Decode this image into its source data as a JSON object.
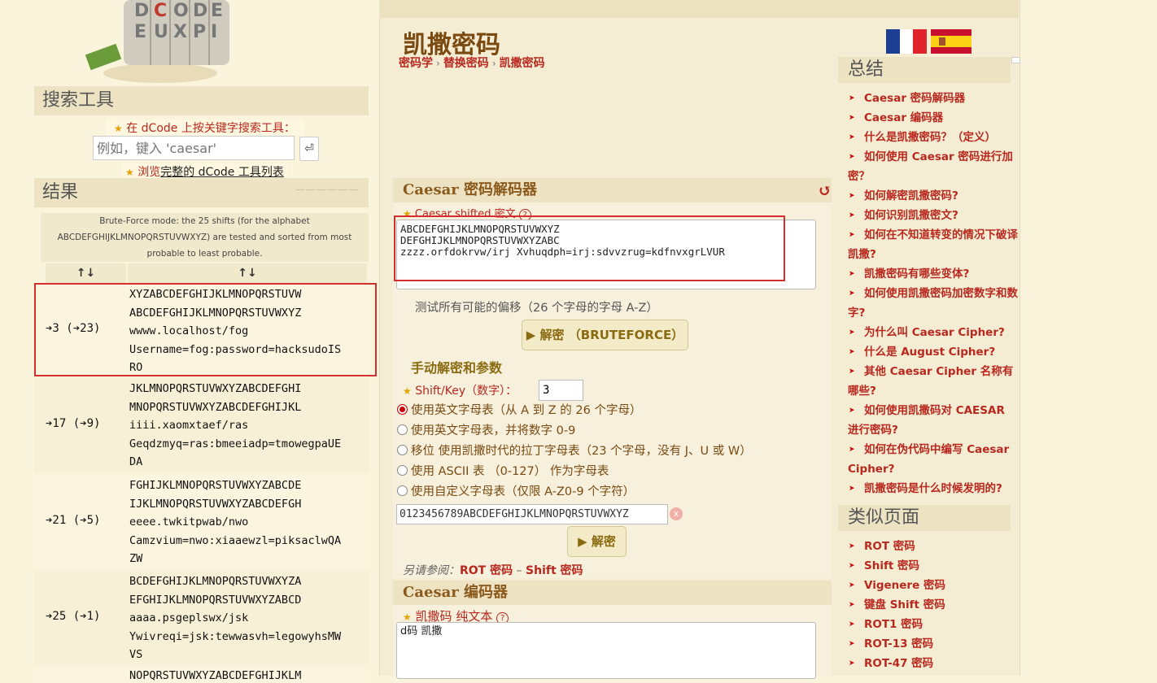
{
  "left": {
    "logo_letters": "DCODE",
    "search_title": "搜索工具",
    "search_intro": "在 dCode 上按关键字搜索工具：",
    "search_placeholder": "例如，键入 'caesar'",
    "search_btn": "⏎",
    "browse_prefix": "浏览",
    "browse_link": "完整的 dCode 工具列表",
    "results_title": "结果",
    "results_note": "Brute-Force mode: the 25 shifts (for the alphabet ABCDEFGHIJKLMNOPQRSTUVWXYZ) are tested and sorted from most probable to least probable.",
    "col1": "↑↓",
    "col2": "↑↓",
    "rows": [
      {
        "shift": "➔3 (➔23)",
        "lines": [
          "XYZABCDEFGHIJKLMNOPQRSTUVW",
          "ABCDEFGHIJKLMNOPQRSTUVWXYZ",
          "wwww.localhost/fog",
          "Username=fog:password=hacksudoIS",
          "RO"
        ]
      },
      {
        "shift": "➔17 (➔9)",
        "lines": [
          "JKLMNOPQRSTUVWXYZABCDEFGHI",
          "MNOPQRSTUVWXYZABCDEFGHIJKL",
          "iiii.xaomxtaef/ras",
          "Geqdzmyq=ras:bmeeiadp=tmowegpaUE",
          "DA"
        ]
      },
      {
        "shift": "➔21 (➔5)",
        "lines": [
          "FGHIJKLMNOPQRSTUVWXYZABCDE",
          "IJKLMNOPQRSTUVWXYZABCDEFGH",
          "eeee.twkitpwab/nwo",
          "Camzvium=nwo:xiaaewzl=piksaclwQA",
          "ZW"
        ]
      },
      {
        "shift": "➔25 (➔1)",
        "lines": [
          "BCDEFGHIJKLMNOPQRSTUVWXYZA",
          "EFGHIJKLMNOPQRSTUVWXYZABCD",
          "aaaa.psgeplswx/jsk",
          "Ywivreqi=jsk:tewwasvh=legowyhsMW",
          "VS"
        ]
      },
      {
        "shift": "",
        "lines": [
          "NOPQRSTUVWXYZABCDEFGHIJKLM"
        ]
      }
    ]
  },
  "main": {
    "title": "凯撒密码",
    "breadcrumb": [
      "密码学",
      "替换密码",
      "凯撒密码"
    ],
    "decoder_title": "Caesar 密码解码器",
    "reset_icon": "↺",
    "cipher_label": "Caesar shifted 密文",
    "help": "?",
    "ciphertext": "ABCDEFGHIJKLMNOPQRSTUVWXYZ\nDEFGHIJKLMNOPQRSTUVWXYZABC\nzzzz.orfdokrvw/irj Xvhuqdph=irj:sdvvzrug=kdfnvxgrLVUR",
    "test_all": "测试所有可能的偏移（26 个字母的字母 A-Z）",
    "brute_btn": "▶ 解密 （BRUTEFORCE）",
    "manual_title": "手动解密和参数",
    "shift_label": "Shift/Key（数字）：",
    "shift_value": "3",
    "options": [
      "使用英文字母表（从 A 到 Z 的 26 个字母）",
      "使用英文字母表，并将数字 0-9",
      "移位 使用凯撒时代的拉丁字母表（23 个字母，没有 J、U 或 W）",
      "使用 ASCII 表 （0-127） 作为字母表",
      "使用自定义字母表（仅限 A-Z0-9 个字符）"
    ],
    "custom_alphabet": "0123456789ABCDEFGHIJKLMNOPQRSTUVWXYZ",
    "clear_icon": "x",
    "decrypt_btn": "▶ 解密",
    "see_also_prefix": "另请参阅：",
    "see_also_1": "ROT 密码",
    "see_also_sep": " – ",
    "see_also_2": "Shift 密码",
    "encoder_title": "Caesar 编码器",
    "plain_label": "凯撒码 纯文本",
    "plaintext": "d码 凯撒"
  },
  "right": {
    "summary_title": "总结",
    "summary_items": [
      "Caesar 密码解码器",
      "Caesar 编码器",
      "什么是凯撒密码？（定义）",
      "如何使用 Caesar 密码进行加密？",
      "如何解密凯撒密码?",
      "如何识别凯撒密文?",
      "如何在不知道转变的情况下破译凯撒?",
      "凯撒密码有哪些变体?",
      "如何使用凯撒密码加密数字和数字?",
      "为什么叫 Caesar Cipher?",
      "什么是 August Cipher?",
      "其他 Caesar Cipher 名称有哪些?",
      "如何使用凯撒码对 CAESAR 进行密码?",
      "如何在伪代码中编写 Caesar Cipher?",
      "凯撒密码是什么时候发明的?"
    ],
    "similar_title": "类似页面",
    "similar_items": [
      "ROT 密码",
      "Shift 密码",
      "Vigenere 密码",
      "键盘 Shift 密码",
      "ROT1 密码",
      "ROT-13 密码",
      "ROT-47 密码"
    ]
  },
  "colors": {
    "accent_red": "#b8281e",
    "highlight_box": "#d32f2f",
    "bg": "#fbf4dc"
  }
}
